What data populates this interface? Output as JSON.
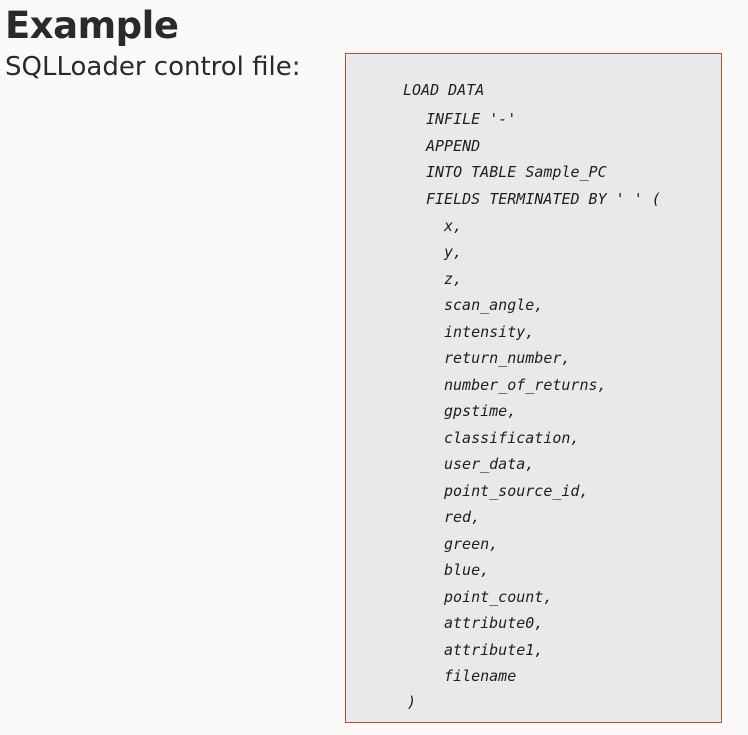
{
  "title": "Example",
  "subtitle": "SQLLoader control file:",
  "code": {
    "line_load_data": "LOAD DATA",
    "line_infile": "INFILE '-'",
    "line_append": "APPEND",
    "line_into_table": "INTO TABLE Sample_PC",
    "line_fields": "FIELDS TERMINATED BY ' ' (",
    "fields": [
      "x,",
      "y,",
      "z,",
      "scan_angle,",
      "intensity,",
      "return_number,",
      "number_of_returns,",
      "gpstime,",
      "classification,",
      "user_data,",
      "point_source_id,",
      "red,",
      "green,",
      "blue,",
      "point_count,",
      "attribute0,",
      "attribute1,",
      "filename"
    ],
    "line_close": ")"
  }
}
